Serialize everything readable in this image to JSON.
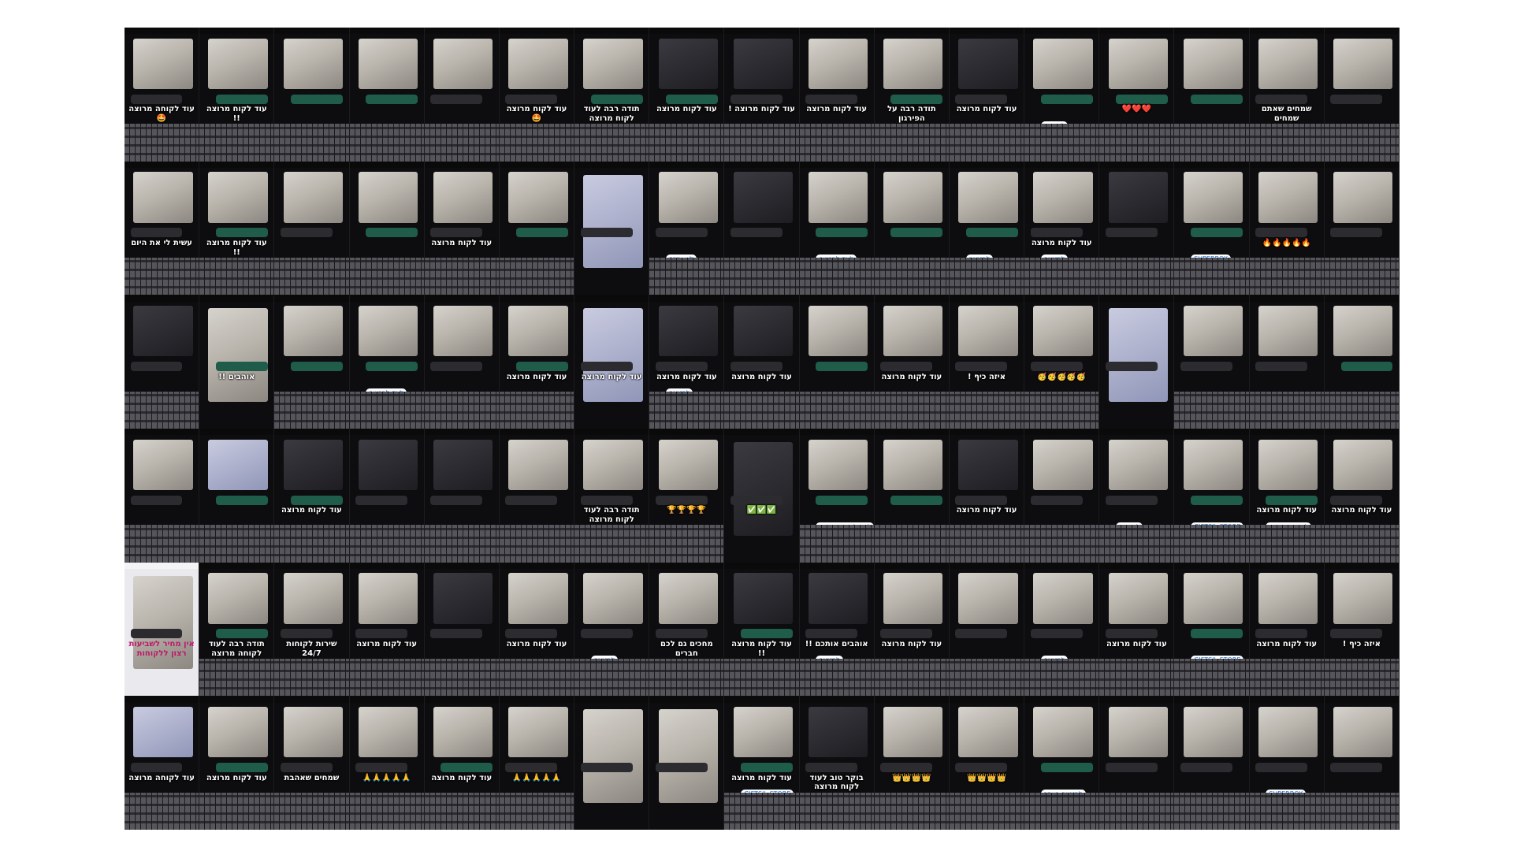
{
  "collage": {
    "columns": 17,
    "rows": 6,
    "tiles": [
      {
        "caption": "עוד לקוחה מרוצה 🤩",
        "shot": "light",
        "bubble": "in"
      },
      {
        "caption": "עוד לקוח מרוצה !!",
        "shot": "light",
        "bubble": "out"
      },
      {
        "caption": "",
        "shot": "light",
        "bubble": "out"
      },
      {
        "caption": "",
        "shot": "light",
        "bubble": "out"
      },
      {
        "caption": "",
        "shot": "light",
        "bubble": "in"
      },
      {
        "caption": "עוד לקוח מרוצה 🤩",
        "shot": "light",
        "bubble": "in"
      },
      {
        "caption": "תודה רבה לעוד לקוח מרוצה",
        "shot": "light",
        "bubble": "out"
      },
      {
        "caption": "עוד לקוח מרוצה",
        "shot": "dark",
        "bubble": "out"
      },
      {
        "caption": "עוד לקוח מרוצה !",
        "shot": "dark",
        "bubble": "in"
      },
      {
        "caption": "עוד לקוח מרוצה",
        "shot": "light",
        "bubble": "in"
      },
      {
        "caption": "תודה רבה על הפירגון",
        "shot": "light",
        "bubble": "out"
      },
      {
        "caption": "עוד לקוח מרוצה",
        "shot": "dark",
        "bubble": "in"
      },
      {
        "caption": "",
        "shot": "light",
        "bubble": "out",
        "pill": "להזמנה"
      },
      {
        "caption": "❤️❤️❤️",
        "shot": "light",
        "bubble": "out"
      },
      {
        "caption": "",
        "shot": "light",
        "bubble": "out"
      },
      {
        "caption": "שמחים שאתם שמחים",
        "shot": "light",
        "bubble": "in"
      },
      {
        "caption": "",
        "shot": "light",
        "bubble": "in"
      },
      {
        "caption": "עשית לי את היום",
        "shot": "light",
        "bubble": "in"
      },
      {
        "caption": "עוד לקוח מרוצה !!",
        "shot": "light",
        "bubble": "out"
      },
      {
        "caption": "",
        "shot": "light",
        "bubble": "in"
      },
      {
        "caption": "",
        "shot": "light",
        "bubble": "out"
      },
      {
        "caption": "עוד לקוח מרוצה",
        "shot": "light",
        "bubble": "in"
      },
      {
        "caption": "",
        "shot": "light",
        "bubble": "out"
      },
      {
        "caption": "",
        "shot": "blue",
        "bubble": "in",
        "nokb": true
      },
      {
        "caption": "",
        "shot": "light",
        "bubble": "in",
        "pill": "ליון עזיזה"
      },
      {
        "caption": "",
        "shot": "dark",
        "bubble": "in"
      },
      {
        "caption": "",
        "shot": "light",
        "bubble": "out",
        "pill": "לינק לרכישה"
      },
      {
        "caption": "",
        "shot": "light",
        "bubble": "out"
      },
      {
        "caption": "",
        "shot": "light",
        "bubble": "out",
        "pill": "להזמנה"
      },
      {
        "caption": "עוד לקוח מרוצה",
        "shot": "light",
        "bubble": "in",
        "pill": "להזמנה"
      },
      {
        "caption": "",
        "shot": "dark",
        "bubble": "in"
      },
      {
        "caption": "",
        "shot": "light",
        "bubble": "out",
        "pill": "SUPERBOX"
      },
      {
        "caption": "🔥🔥🔥🔥🔥",
        "shot": "light",
        "bubble": "in"
      },
      {
        "caption": "",
        "shot": "light",
        "bubble": "in"
      },
      {
        "caption": "",
        "shot": "dark",
        "bubble": "in"
      },
      {
        "caption": "אוהבים !!",
        "shot": "light",
        "bubble": "out",
        "nokb": true
      },
      {
        "caption": "",
        "shot": "light",
        "bubble": "out"
      },
      {
        "caption": "",
        "shot": "light",
        "bubble": "out",
        "pill": "לינק לרכישה"
      },
      {
        "caption": "",
        "shot": "light",
        "bubble": "in"
      },
      {
        "caption": "עוד לקוח מרוצה",
        "shot": "light",
        "bubble": "out"
      },
      {
        "caption": "עוד לקוח מרוצה",
        "shot": "blue",
        "bubble": "in",
        "nokb": true
      },
      {
        "caption": "עוד לקוח מרוצה",
        "shot": "dark",
        "bubble": "in",
        "pill": "להזמנה"
      },
      {
        "caption": "עוד לקוח מרוצה",
        "shot": "dark",
        "bubble": "in"
      },
      {
        "caption": "",
        "shot": "light",
        "bubble": "out"
      },
      {
        "caption": "עוד לקוח מרוצה",
        "shot": "light",
        "bubble": "in"
      },
      {
        "caption": "איזה כיף !",
        "shot": "light",
        "bubble": "in"
      },
      {
        "caption": "🥳🥳🥳🥳🥳",
        "shot": "light",
        "bubble": "in"
      },
      {
        "caption": "",
        "shot": "blue",
        "bubble": "in",
        "nokb": true
      },
      {
        "caption": "",
        "shot": "light",
        "bubble": "in"
      },
      {
        "caption": "",
        "shot": "light",
        "bubble": "in"
      },
      {
        "caption": "",
        "shot": "light",
        "bubble": "out"
      },
      {
        "caption": "",
        "shot": "light",
        "bubble": "in"
      },
      {
        "caption": "",
        "shot": "blue",
        "bubble": "out"
      },
      {
        "caption": "עוד לקוח מרוצה",
        "shot": "dark",
        "bubble": "out"
      },
      {
        "caption": "",
        "shot": "dark",
        "bubble": "in"
      },
      {
        "caption": "",
        "shot": "dark",
        "bubble": "in"
      },
      {
        "caption": "",
        "shot": "light",
        "bubble": "in"
      },
      {
        "caption": "תודה רבה לעוד לקוח מרוצה",
        "shot": "light",
        "bubble": "in"
      },
      {
        "caption": "🏆🏆🏆🏆",
        "shot": "light",
        "bubble": "in"
      },
      {
        "caption": "✅✅✅",
        "shot": "dark",
        "bubble": "in",
        "nokb": true
      },
      {
        "caption": "",
        "shot": "light",
        "bubble": "out",
        "pill": "לינק לרכישה באתר"
      },
      {
        "caption": "",
        "shot": "light",
        "bubble": "out"
      },
      {
        "caption": "עוד לקוח מרוצה",
        "shot": "dark",
        "bubble": "in"
      },
      {
        "caption": "",
        "shot": "light",
        "bubble": "in"
      },
      {
        "caption": "",
        "shot": "light",
        "bubble": "in",
        "pill": "להזמנה"
      },
      {
        "caption": "",
        "shot": "light",
        "bubble": "out",
        "pill": "GIFTSIL.STORE"
      },
      {
        "caption": "עוד לקוח מרוצה",
        "shot": "light",
        "bubble": "out",
        "pill": "להזמנה מראש"
      },
      {
        "caption": "עוד לקוח מרוצה",
        "shot": "light",
        "bubble": "in"
      },
      {
        "caption": "אין מחיר לשביעות רצון ללקוחות",
        "shot": "light",
        "bubble": "in",
        "light": true,
        "nokb": true
      },
      {
        "caption": "תודה רבה לעוד לקוחה מרוצה",
        "shot": "light",
        "bubble": "out"
      },
      {
        "caption": "שירות לקוחות 24/7",
        "shot": "light",
        "bubble": "in"
      },
      {
        "caption": "עוד לקוח מרוצה",
        "shot": "light",
        "bubble": "in"
      },
      {
        "caption": "",
        "shot": "dark",
        "bubble": "in"
      },
      {
        "caption": "עוד לקוח מרוצה",
        "shot": "light",
        "bubble": "in"
      },
      {
        "caption": "",
        "shot": "light",
        "bubble": "in",
        "pill": "להזמנה"
      },
      {
        "caption": "מחכים גם לכם חברים",
        "shot": "photo",
        "bubble": "in"
      },
      {
        "caption": "עוד לקוח מרוצה !!",
        "shot": "dark",
        "bubble": "out"
      },
      {
        "caption": "אוהבים אותכם !!",
        "shot": "dark",
        "bubble": "in",
        "pill": "להזמנה"
      },
      {
        "caption": "עוד לקוח מרוצה",
        "shot": "light",
        "bubble": "in"
      },
      {
        "caption": "",
        "shot": "light",
        "bubble": "in"
      },
      {
        "caption": "",
        "shot": "light",
        "bubble": "in",
        "pill": "להזמנה"
      },
      {
        "caption": "עוד לקוח מרוצה",
        "shot": "light",
        "bubble": "in"
      },
      {
        "caption": "",
        "shot": "light",
        "bubble": "out",
        "pill": "GIFTSIL.STORE"
      },
      {
        "caption": "עוד לקוח מרוצה",
        "shot": "light",
        "bubble": "in"
      },
      {
        "caption": "איזה כיף !",
        "shot": "light",
        "bubble": "in"
      },
      {
        "caption": "עוד לקוחה מרוצה",
        "shot": "blue",
        "bubble": "in"
      },
      {
        "caption": "עוד לקוח מרוצה",
        "shot": "light",
        "bubble": "out"
      },
      {
        "caption": "שמחים שאהבת",
        "shot": "light",
        "bubble": "in"
      },
      {
        "caption": "🙏🙏🙏🙏🙏",
        "shot": "light",
        "bubble": "in"
      },
      {
        "caption": "עוד לקוח מרוצה",
        "shot": "light",
        "bubble": "out"
      },
      {
        "caption": "🙏🙏🙏🙏🙏",
        "shot": "light",
        "bubble": "in"
      },
      {
        "caption": "",
        "shot": "light",
        "bubble": "in",
        "nokb": true
      },
      {
        "caption": "",
        "shot": "photo",
        "bubble": "in",
        "nokb": true
      },
      {
        "caption": "עוד לקוח מרוצה",
        "shot": "light",
        "bubble": "out",
        "pill": "GIFTSIL.STORE"
      },
      {
        "caption": "בוקר טוב לעוד לקוח מרוצה",
        "shot": "dark",
        "bubble": "in"
      },
      {
        "caption": "👑👑👑👑",
        "shot": "light",
        "bubble": "in"
      },
      {
        "caption": "👑👑👑👑",
        "shot": "light",
        "bubble": "in"
      },
      {
        "caption": "",
        "shot": "light",
        "bubble": "out",
        "pill": "להזמנה באתר"
      },
      {
        "caption": "",
        "shot": "light",
        "bubble": "in"
      },
      {
        "caption": "",
        "shot": "light",
        "bubble": "in"
      },
      {
        "caption": "",
        "shot": "light",
        "bubble": "in",
        "pill": "SUPERBOX"
      },
      {
        "caption": "",
        "shot": "light",
        "bubble": "in"
      }
    ]
  }
}
